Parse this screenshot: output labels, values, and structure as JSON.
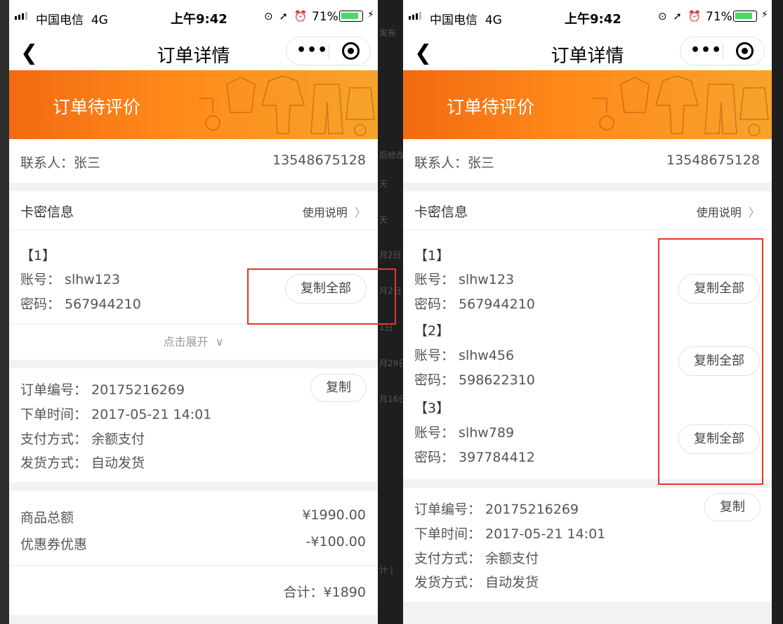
{
  "status_bar": {
    "carrier": "中国电信",
    "network": "4G",
    "time": "上午9:42",
    "battery": "71%"
  },
  "nav": {
    "title": "订单详情"
  },
  "banner": {
    "text": "订单待评价"
  },
  "contact": {
    "label": "联系人：张三",
    "phone": "13548675128"
  },
  "card_section": {
    "title": "卡密信息",
    "help_link": "使用说明"
  },
  "cards": [
    {
      "index": "【1】",
      "account": "账号：  slhw123",
      "password": "密码：  567944210",
      "copy_label": "复制全部"
    },
    {
      "index": "【2】",
      "account": "账号：  slhw456",
      "password": "密码：  598622310",
      "copy_label": "复制全部"
    },
    {
      "index": "【3】",
      "account": "账号：  slhw789",
      "password": "密码：  397784412",
      "copy_label": "复制全部"
    }
  ],
  "expand_label": "点击展开",
  "order": {
    "number": "订单编号：  20175216269",
    "time": "下单时间：  2017-05-21   14:01",
    "payment": "支付方式：  余额支付",
    "delivery": "发货方式：  自动发货",
    "copy_label": "复制"
  },
  "summary": {
    "goods_label": "商品总额",
    "goods_value": "¥1990.00",
    "coupon_label": "优惠券优惠",
    "coupon_value": "-¥100.00",
    "total": "合计：¥1890"
  },
  "background_fragments": [
    "发布",
    "后修改",
    "天",
    "天",
    "月2日",
    "月2日",
    "1日",
    "月29日",
    "月16日",
    "计 |"
  ],
  "colors": {
    "accent": "#f26a12",
    "highlight": "#e8342c",
    "battery": "#4cd964"
  }
}
